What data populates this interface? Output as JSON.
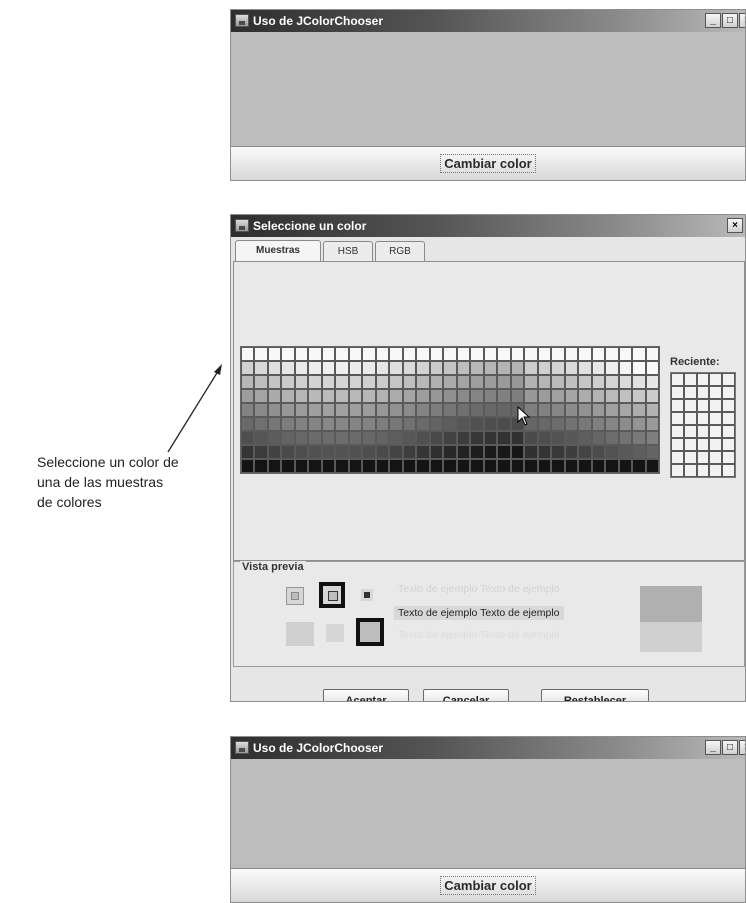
{
  "window_top": {
    "title": "Uso de JColorChooser",
    "controls": {
      "minimize": "_",
      "maximize": "□",
      "close": "×"
    },
    "button_label": "Cambiar color"
  },
  "dialog": {
    "title": "Seleccione un color",
    "close": "×",
    "tabs": [
      "Muestras",
      "HSB",
      "RGB"
    ],
    "recent_label": "Reciente:",
    "preview_label": "Vista previa",
    "sample_text": "Texto de ejemplo  Texto de ejemplo",
    "buttons": {
      "ok": "Aceptar",
      "cancel": "Cancelar",
      "reset": "Restablecer"
    }
  },
  "window_bottom": {
    "title": "Uso de JColorChooser",
    "controls": {
      "minimize": "_",
      "maximize": "□",
      "close": "×"
    },
    "button_label": "Cambiar color"
  },
  "annotation": {
    "lines": [
      "Seleccione un color de",
      "una de las muestras",
      "de colores"
    ]
  },
  "colors": {
    "canvas": "#bdbdbd",
    "canvas_after": "#bdbdbd",
    "preview_swatch_dark": "#b0b0b0",
    "preview_swatch_light": "#cfcfcf"
  }
}
